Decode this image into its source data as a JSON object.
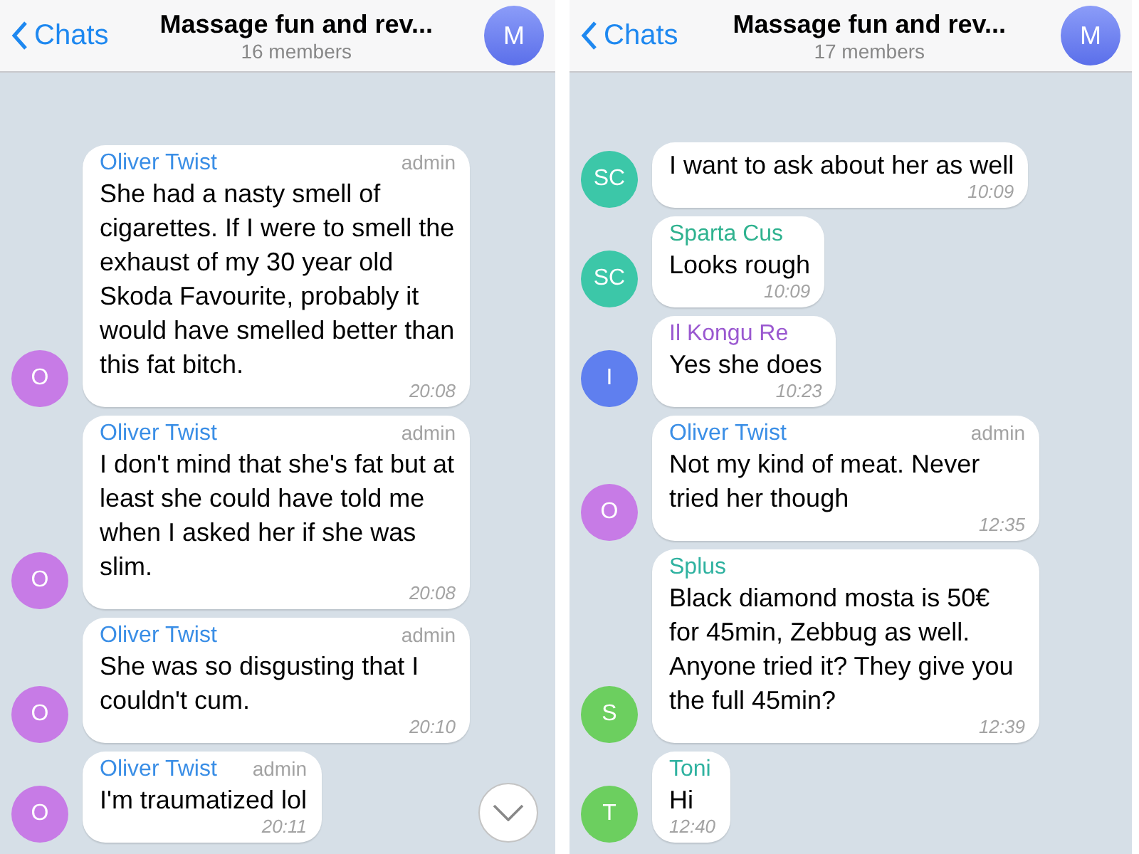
{
  "panels": [
    {
      "header": {
        "back_label": "Chats",
        "title": "Massage fun and rev...",
        "subtitle": "16 members",
        "avatar_letter": "M"
      },
      "scroll_down_button": true,
      "messages": [
        {
          "sender": "Oliver Twist",
          "color": "#3a8ee6",
          "role": "admin",
          "text": "She had a nasty smell of cigarettes. If I were to smell the exhaust of my 30 year old Skoda Favourite, probably it would have smelled better than this fat bitch.",
          "time": "20:08",
          "avatar": {
            "letter": "O",
            "color": "#c77be6"
          }
        },
        {
          "sender": "Oliver Twist",
          "color": "#3a8ee6",
          "role": "admin",
          "text": "I don't mind that she's fat but at least she could have told me when I asked her if she was slim.",
          "time": "20:08",
          "avatar": {
            "letter": "O",
            "color": "#c77be6"
          }
        },
        {
          "sender": "Oliver Twist",
          "color": "#3a8ee6",
          "role": "admin",
          "text": "She was so disgusting that I couldn't cum.",
          "time": "20:10",
          "avatar": {
            "letter": "O",
            "color": "#c77be6"
          }
        },
        {
          "sender": "Oliver Twist",
          "color": "#3a8ee6",
          "role": "admin",
          "text": "I'm traumatized lol",
          "time": "20:11",
          "avatar": {
            "letter": "O",
            "color": "#c77be6"
          }
        }
      ]
    },
    {
      "header": {
        "back_label": "Chats",
        "title": "Massage fun and rev...",
        "subtitle": "17 members",
        "avatar_letter": "M"
      },
      "scroll_down_button": false,
      "messages": [
        {
          "text": "I want to ask about her as well",
          "time": "10:09",
          "avatar": {
            "letter": "SC",
            "color": "#3cc7a8"
          }
        },
        {
          "sender": "Sparta Cus",
          "color": "#2fb28f",
          "text": "Looks rough",
          "time": "10:09",
          "avatar": {
            "letter": "SC",
            "color": "#3cc7a8"
          }
        },
        {
          "sender": "Il Kongu Re",
          "color": "#9a58d0",
          "text": "Yes she does",
          "time": "10:23",
          "avatar": {
            "letter": "I",
            "color": "#5f7fef"
          }
        },
        {
          "sender": "Oliver Twist",
          "color": "#3a8ee6",
          "role": "admin",
          "text": "Not my kind of meat. Never tried her though",
          "time": "12:35",
          "avatar": {
            "letter": "O",
            "color": "#c77be6"
          }
        },
        {
          "sender": "Splus",
          "color": "#2fb2a0",
          "text": "Black diamond mosta is 50€ for 45min, Zebbug as well. Anyone tried it? They give you the full 45min?",
          "time": "12:39",
          "avatar": {
            "letter": "S",
            "color": "#6ccf5f"
          }
        },
        {
          "sender": "Toni",
          "color": "#2fb2a0",
          "text": "Hi",
          "time": "12:40",
          "avatar": {
            "letter": "T",
            "color": "#6ccf5f"
          }
        }
      ]
    }
  ]
}
